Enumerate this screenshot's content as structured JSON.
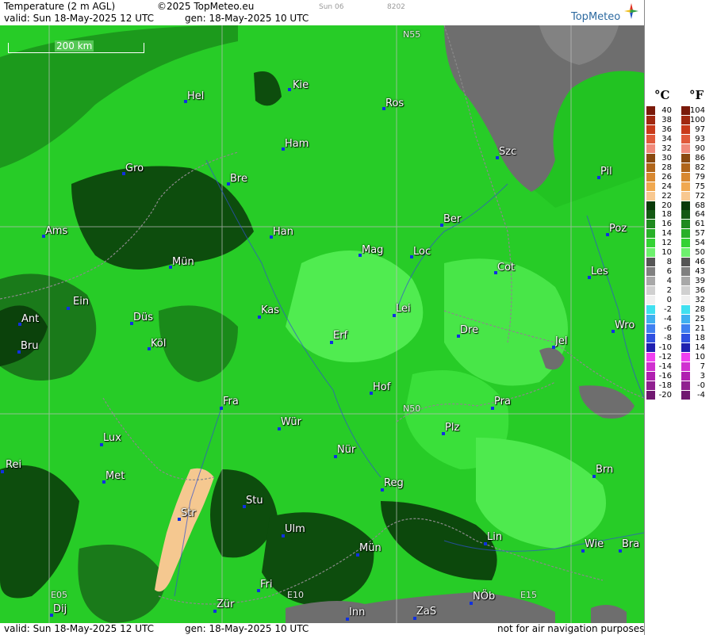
{
  "header": {
    "title": "Temperature (2 m AGL)",
    "copyright": "©2025 TopMeteo.eu",
    "valid": "valid:  Sun  18-May-2025  12 UTC",
    "generated": "gen: 18-May-2025 10 UTC",
    "day_code": "Sun 06",
    "code": "8202",
    "logo": "TopMeteo"
  },
  "scale_bar": {
    "label": "200 km"
  },
  "grid_labels": [
    {
      "label": "N55"
    },
    {
      "label": "N50"
    },
    {
      "label": "E05"
    },
    {
      "label": "E10"
    },
    {
      "label": "E15"
    }
  ],
  "cities": [
    {
      "name": "Kie"
    },
    {
      "name": "Hel"
    },
    {
      "name": "Ros"
    },
    {
      "name": "Ham"
    },
    {
      "name": "Szc"
    },
    {
      "name": "Gro"
    },
    {
      "name": "Bre"
    },
    {
      "name": "Pil"
    },
    {
      "name": "Ber"
    },
    {
      "name": "Ams"
    },
    {
      "name": "Han"
    },
    {
      "name": "Poz"
    },
    {
      "name": "Mag"
    },
    {
      "name": "Loc"
    },
    {
      "name": "Mün"
    },
    {
      "name": "Cot"
    },
    {
      "name": "Les"
    },
    {
      "name": "Ein"
    },
    {
      "name": "Kas"
    },
    {
      "name": "Lei"
    },
    {
      "name": "Ant"
    },
    {
      "name": "Düs"
    },
    {
      "name": "Dre"
    },
    {
      "name": "Wro"
    },
    {
      "name": "Erf"
    },
    {
      "name": "Bru"
    },
    {
      "name": "Köl"
    },
    {
      "name": "Jel"
    },
    {
      "name": "Hof"
    },
    {
      "name": "Fra"
    },
    {
      "name": "Pra"
    },
    {
      "name": "Wür"
    },
    {
      "name": "Plz"
    },
    {
      "name": "Lux"
    },
    {
      "name": "Nür"
    },
    {
      "name": "Rei"
    },
    {
      "name": "Met"
    },
    {
      "name": "Reg"
    },
    {
      "name": "Brn"
    },
    {
      "name": "Stu"
    },
    {
      "name": "Str"
    },
    {
      "name": "Ulm"
    },
    {
      "name": "Lin"
    },
    {
      "name": "Wie"
    },
    {
      "name": "Bra"
    },
    {
      "name": "Mün"
    },
    {
      "name": "Fri"
    },
    {
      "name": "NÖb"
    },
    {
      "name": "Dij"
    },
    {
      "name": "Zür"
    },
    {
      "name": "Inn"
    },
    {
      "name": "ZaS"
    }
  ],
  "footer": {
    "valid": "valid:  Sun  18-May-2025  12 UTC",
    "generated": "gen: 18-May-2025 10 UTC",
    "note": "not for air navigation purposes"
  },
  "legend": {
    "unit_c": "°C",
    "unit_f": "°F",
    "rows": [
      {
        "c": "40",
        "f": "104",
        "color": "#7a1a0a"
      },
      {
        "c": "38",
        "f": "100",
        "color": "#a02810"
      },
      {
        "c": "36",
        "f": "97",
        "color": "#c83a1a"
      },
      {
        "c": "34",
        "f": "93",
        "color": "#e05a3a"
      },
      {
        "c": "32",
        "f": "90",
        "color": "#f08a7a"
      },
      {
        "c": "30",
        "f": "86",
        "color": "#8a4a10"
      },
      {
        "c": "28",
        "f": "82",
        "color": "#b0651a"
      },
      {
        "c": "26",
        "f": "79",
        "color": "#d88830"
      },
      {
        "c": "24",
        "f": "75",
        "color": "#f0a850"
      },
      {
        "c": "22",
        "f": "72",
        "color": "#f8c890"
      },
      {
        "c": "20",
        "f": "68",
        "color": "#0a3a0a"
      },
      {
        "c": "18",
        "f": "64",
        "color": "#145a14"
      },
      {
        "c": "16",
        "f": "61",
        "color": "#1f8a1f"
      },
      {
        "c": "14",
        "f": "57",
        "color": "#28b028"
      },
      {
        "c": "12",
        "f": "54",
        "color": "#34d234"
      },
      {
        "c": "10",
        "f": "50",
        "color": "#6ef06e"
      },
      {
        "c": "8",
        "f": "46",
        "color": "#555555"
      },
      {
        "c": "6",
        "f": "43",
        "color": "#808080"
      },
      {
        "c": "4",
        "f": "39",
        "color": "#a8a8a8"
      },
      {
        "c": "2",
        "f": "36",
        "color": "#d0d0d0"
      },
      {
        "c": "0",
        "f": "32",
        "color": "#f0f0f0"
      },
      {
        "c": "-2",
        "f": "28",
        "color": "#40e0f0"
      },
      {
        "c": "-4",
        "f": "25",
        "color": "#40b0f0"
      },
      {
        "c": "-6",
        "f": "21",
        "color": "#4080f0"
      },
      {
        "c": "-8",
        "f": "18",
        "color": "#3050e0"
      },
      {
        "c": "-10",
        "f": "14",
        "color": "#2020b0"
      },
      {
        "c": "-12",
        "f": "10",
        "color": "#f040f0"
      },
      {
        "c": "-14",
        "f": "7",
        "color": "#d030d0"
      },
      {
        "c": "-16",
        "f": "3",
        "color": "#b020b0"
      },
      {
        "c": "-18",
        "f": "-0",
        "color": "#902090"
      },
      {
        "c": "-20",
        "f": "-4",
        "color": "#701870"
      }
    ]
  },
  "colors": {
    "green_dark": "#0a4a0a",
    "green_mid": "#1f8a1f",
    "green_base": "#22c322",
    "green_light": "#4ee84e",
    "sea_gray": "#6e6e6e",
    "warm_patch": "#f5c890"
  }
}
